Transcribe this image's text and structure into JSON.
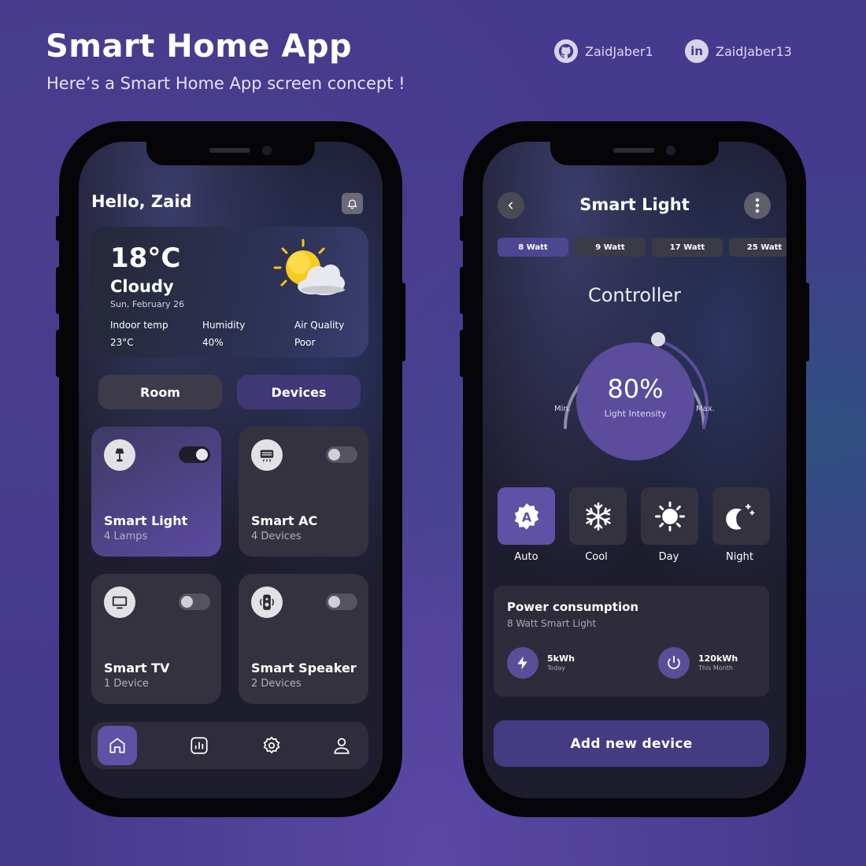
{
  "header": {
    "title": "Smart Home App",
    "subtitle": "Here’s a Smart Home App screen concept !",
    "github": "ZaidJaber1",
    "linkedin": "ZaidJaber13"
  },
  "home": {
    "greeting": "Hello, Zaid",
    "weather": {
      "temp": "18°C",
      "condition": "Cloudy",
      "date": "Sun, February 26",
      "stats": [
        {
          "label": "Indoor temp",
          "value": "23°C"
        },
        {
          "label": "Humidity",
          "value": "40%"
        },
        {
          "label": "Air Quality",
          "value": "Poor"
        }
      ]
    },
    "tabs": [
      "Room",
      "Devices"
    ],
    "devices": [
      {
        "name": "Smart Light",
        "count": "4 Lamps",
        "on": true
      },
      {
        "name": "Smart AC",
        "count": "4 Devices",
        "on": false
      },
      {
        "name": "Smart TV",
        "count": "1 Device",
        "on": false
      },
      {
        "name": "Smart Speaker",
        "count": "2 Devices",
        "on": false
      }
    ]
  },
  "light": {
    "title": "Smart Light",
    "watts": [
      "8 Watt",
      "9 Watt",
      "17 Watt",
      "25 Watt"
    ],
    "controller_label": "Controller",
    "intensity": "80%",
    "intensity_label": "Light Intensity",
    "min": "Min.",
    "max": "Max.",
    "modes": [
      "Auto",
      "Cool",
      "Day",
      "Night"
    ],
    "power": {
      "title": "Power consumption",
      "subtitle": "8 Watt Smart Light",
      "today_value": "5kWh",
      "today_label": "Today",
      "month_value": "120kWh",
      "month_label": "This Month"
    },
    "add_button": "Add new device"
  },
  "colors": {
    "accent": "#5b4c9c",
    "background": "#463a8e"
  }
}
